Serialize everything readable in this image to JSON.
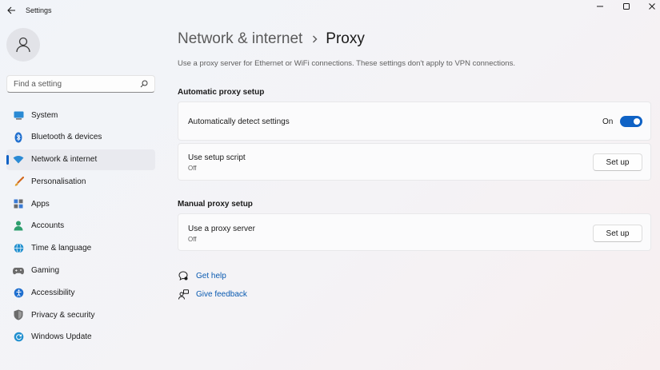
{
  "window": {
    "title": "Settings",
    "controls": [
      "minimize",
      "maximize",
      "close"
    ]
  },
  "sidebar": {
    "search_placeholder": "Find a setting",
    "items": [
      {
        "label": "System",
        "icon": "system-icon",
        "color": "#0f62c5"
      },
      {
        "label": "Bluetooth & devices",
        "icon": "bluetooth-icon",
        "color": "#0f62c5"
      },
      {
        "label": "Network & internet",
        "icon": "network-icon",
        "color": "#0f62c5",
        "active": true
      },
      {
        "label": "Personalisation",
        "icon": "brush-icon",
        "color": "#d2691e"
      },
      {
        "label": "Apps",
        "icon": "apps-icon",
        "color": "#3a7bd5"
      },
      {
        "label": "Accounts",
        "icon": "accounts-icon",
        "color": "#2e9e6e"
      },
      {
        "label": "Time & language",
        "icon": "globe-icon",
        "color": "#1f8fcf"
      },
      {
        "label": "Gaming",
        "icon": "gaming-icon",
        "color": "#6b6b6b"
      },
      {
        "label": "Accessibility",
        "icon": "accessibility-icon",
        "color": "#1f6fcf"
      },
      {
        "label": "Privacy & security",
        "icon": "shield-icon",
        "color": "#6b6b6b"
      },
      {
        "label": "Windows Update",
        "icon": "update-icon",
        "color": "#1f8fcf"
      }
    ]
  },
  "main": {
    "breadcrumb": {
      "parent": "Network & internet",
      "current": "Proxy"
    },
    "description": "Use a proxy server for Ethernet or WiFi connections. These settings don't apply to VPN connections.",
    "automatic": {
      "title": "Automatic proxy setup",
      "detect": {
        "label": "Automatically detect settings",
        "state": "On",
        "enabled": true
      },
      "script": {
        "label": "Use setup script",
        "status": "Off",
        "button": "Set up"
      }
    },
    "manual": {
      "title": "Manual proxy setup",
      "server": {
        "label": "Use a proxy server",
        "status": "Off",
        "button": "Set up"
      }
    },
    "links": {
      "help": "Get help",
      "feedback": "Give feedback"
    }
  },
  "colors": {
    "accent": "#0f62c5",
    "link": "#0a5ab0"
  }
}
